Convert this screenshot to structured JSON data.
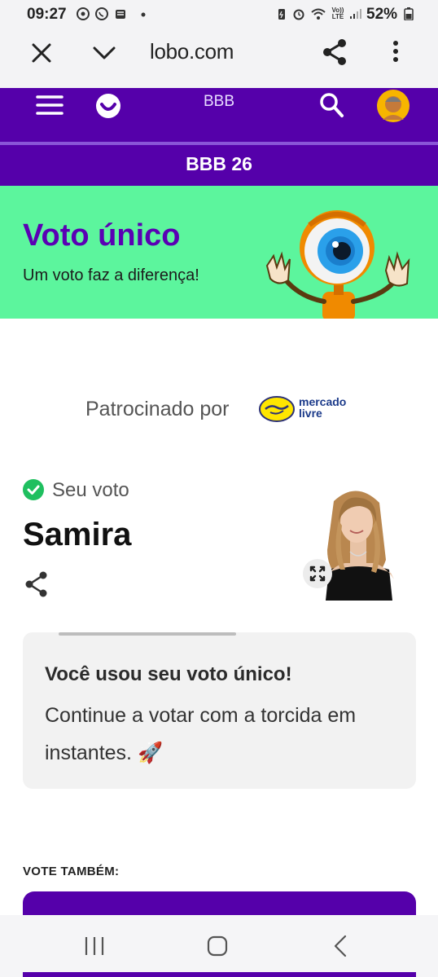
{
  "status_bar": {
    "time": "09:27",
    "battery": "52%",
    "icons": [
      "chrome-icon",
      "whatsapp-icon",
      "notification-icon",
      "dot-icon",
      "battery-saver-icon",
      "alarm-icon",
      "wifi-icon",
      "volte-icon",
      "signal-icon",
      "battery-icon"
    ],
    "volte_label": "Vo)) LTE"
  },
  "browser": {
    "url": "lobo.com",
    "close_icon": "close-icon",
    "dropdown_icon": "chevron-down-icon",
    "share_icon": "share-icon",
    "menu_icon": "more-vertical-icon"
  },
  "site_header": {
    "title": "BBB",
    "section": "BBB 26"
  },
  "banner": {
    "title": "Voto único",
    "subtitle": "Um voto faz a diferença!"
  },
  "sponsor": {
    "label": "Patrocinado por",
    "logo_line1": "mercado",
    "logo_line2": "livre"
  },
  "vote": {
    "label": "Seu voto",
    "name": "Samira"
  },
  "info_card": {
    "title": "Você usou seu voto único!",
    "body": "Continue a votar com a torcida em instantes. 🚀"
  },
  "vote_also": {
    "label": "VOTE TAMBÉM:"
  },
  "colors": {
    "brand_purple": "#5500aa",
    "banner_green": "#5cf59d",
    "check_green": "#1fbf5f"
  }
}
